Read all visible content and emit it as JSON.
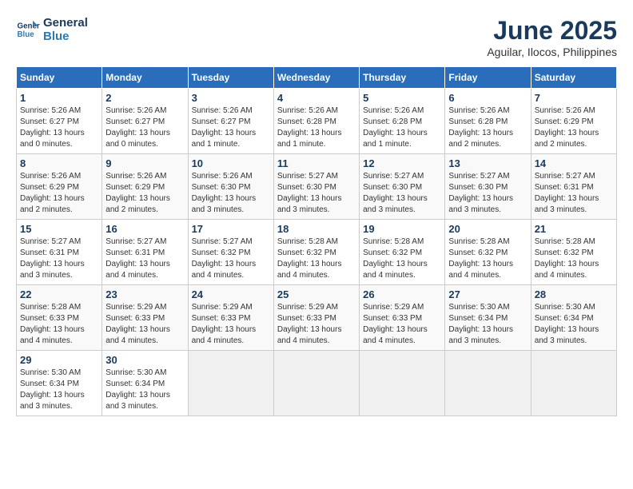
{
  "header": {
    "logo_line1": "General",
    "logo_line2": "Blue",
    "title": "June 2025",
    "subtitle": "Aguilar, Ilocos, Philippines"
  },
  "days_of_week": [
    "Sunday",
    "Monday",
    "Tuesday",
    "Wednesday",
    "Thursday",
    "Friday",
    "Saturday"
  ],
  "weeks": [
    [
      {
        "day": "1",
        "info": "Sunrise: 5:26 AM\nSunset: 6:27 PM\nDaylight: 13 hours\nand 0 minutes."
      },
      {
        "day": "2",
        "info": "Sunrise: 5:26 AM\nSunset: 6:27 PM\nDaylight: 13 hours\nand 0 minutes."
      },
      {
        "day": "3",
        "info": "Sunrise: 5:26 AM\nSunset: 6:27 PM\nDaylight: 13 hours\nand 1 minute."
      },
      {
        "day": "4",
        "info": "Sunrise: 5:26 AM\nSunset: 6:28 PM\nDaylight: 13 hours\nand 1 minute."
      },
      {
        "day": "5",
        "info": "Sunrise: 5:26 AM\nSunset: 6:28 PM\nDaylight: 13 hours\nand 1 minute."
      },
      {
        "day": "6",
        "info": "Sunrise: 5:26 AM\nSunset: 6:28 PM\nDaylight: 13 hours\nand 2 minutes."
      },
      {
        "day": "7",
        "info": "Sunrise: 5:26 AM\nSunset: 6:29 PM\nDaylight: 13 hours\nand 2 minutes."
      }
    ],
    [
      {
        "day": "8",
        "info": "Sunrise: 5:26 AM\nSunset: 6:29 PM\nDaylight: 13 hours\nand 2 minutes."
      },
      {
        "day": "9",
        "info": "Sunrise: 5:26 AM\nSunset: 6:29 PM\nDaylight: 13 hours\nand 2 minutes."
      },
      {
        "day": "10",
        "info": "Sunrise: 5:26 AM\nSunset: 6:30 PM\nDaylight: 13 hours\nand 3 minutes."
      },
      {
        "day": "11",
        "info": "Sunrise: 5:27 AM\nSunset: 6:30 PM\nDaylight: 13 hours\nand 3 minutes."
      },
      {
        "day": "12",
        "info": "Sunrise: 5:27 AM\nSunset: 6:30 PM\nDaylight: 13 hours\nand 3 minutes."
      },
      {
        "day": "13",
        "info": "Sunrise: 5:27 AM\nSunset: 6:30 PM\nDaylight: 13 hours\nand 3 minutes."
      },
      {
        "day": "14",
        "info": "Sunrise: 5:27 AM\nSunset: 6:31 PM\nDaylight: 13 hours\nand 3 minutes."
      }
    ],
    [
      {
        "day": "15",
        "info": "Sunrise: 5:27 AM\nSunset: 6:31 PM\nDaylight: 13 hours\nand 3 minutes."
      },
      {
        "day": "16",
        "info": "Sunrise: 5:27 AM\nSunset: 6:31 PM\nDaylight: 13 hours\nand 4 minutes."
      },
      {
        "day": "17",
        "info": "Sunrise: 5:27 AM\nSunset: 6:32 PM\nDaylight: 13 hours\nand 4 minutes."
      },
      {
        "day": "18",
        "info": "Sunrise: 5:28 AM\nSunset: 6:32 PM\nDaylight: 13 hours\nand 4 minutes."
      },
      {
        "day": "19",
        "info": "Sunrise: 5:28 AM\nSunset: 6:32 PM\nDaylight: 13 hours\nand 4 minutes."
      },
      {
        "day": "20",
        "info": "Sunrise: 5:28 AM\nSunset: 6:32 PM\nDaylight: 13 hours\nand 4 minutes."
      },
      {
        "day": "21",
        "info": "Sunrise: 5:28 AM\nSunset: 6:32 PM\nDaylight: 13 hours\nand 4 minutes."
      }
    ],
    [
      {
        "day": "22",
        "info": "Sunrise: 5:28 AM\nSunset: 6:33 PM\nDaylight: 13 hours\nand 4 minutes."
      },
      {
        "day": "23",
        "info": "Sunrise: 5:29 AM\nSunset: 6:33 PM\nDaylight: 13 hours\nand 4 minutes."
      },
      {
        "day": "24",
        "info": "Sunrise: 5:29 AM\nSunset: 6:33 PM\nDaylight: 13 hours\nand 4 minutes."
      },
      {
        "day": "25",
        "info": "Sunrise: 5:29 AM\nSunset: 6:33 PM\nDaylight: 13 hours\nand 4 minutes."
      },
      {
        "day": "26",
        "info": "Sunrise: 5:29 AM\nSunset: 6:33 PM\nDaylight: 13 hours\nand 4 minutes."
      },
      {
        "day": "27",
        "info": "Sunrise: 5:30 AM\nSunset: 6:34 PM\nDaylight: 13 hours\nand 3 minutes."
      },
      {
        "day": "28",
        "info": "Sunrise: 5:30 AM\nSunset: 6:34 PM\nDaylight: 13 hours\nand 3 minutes."
      }
    ],
    [
      {
        "day": "29",
        "info": "Sunrise: 5:30 AM\nSunset: 6:34 PM\nDaylight: 13 hours\nand 3 minutes."
      },
      {
        "day": "30",
        "info": "Sunrise: 5:30 AM\nSunset: 6:34 PM\nDaylight: 13 hours\nand 3 minutes."
      },
      {
        "day": "",
        "info": ""
      },
      {
        "day": "",
        "info": ""
      },
      {
        "day": "",
        "info": ""
      },
      {
        "day": "",
        "info": ""
      },
      {
        "day": "",
        "info": ""
      }
    ]
  ]
}
